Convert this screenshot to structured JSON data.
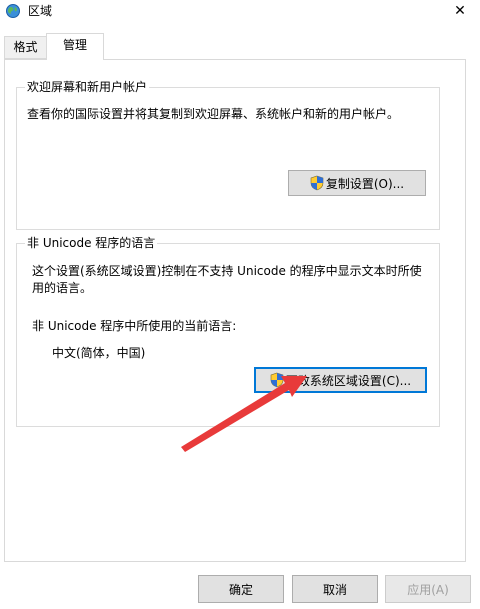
{
  "window": {
    "title": "区域",
    "close_glyph": "✕"
  },
  "tabs": [
    {
      "label": "格式",
      "selected": false
    },
    {
      "label": "管理",
      "selected": true
    }
  ],
  "welcome_group": {
    "title": "欢迎屏幕和新用户帐户",
    "description": "查看你的国际设置并将其复制到欢迎屏幕、系统帐户和新的用户帐户。",
    "copy_button_label": "复制设置(O)..."
  },
  "non_unicode_group": {
    "title": "非 Unicode 程序的语言",
    "description": "这个设置(系统区域设置)控制在不支持 Unicode 的程序中显示文本时所使用的语言。",
    "current_label": "非 Unicode 程序中所使用的当前语言:",
    "current_value": "中文(简体，中国)",
    "change_button_label": "更改系统区域设置(C)..."
  },
  "footer": {
    "ok_label": "确定",
    "cancel_label": "取消",
    "apply_label": "应用(A)"
  },
  "colors": {
    "annotation_arrow": "#e83a3a",
    "focus_border": "#0078d7"
  }
}
